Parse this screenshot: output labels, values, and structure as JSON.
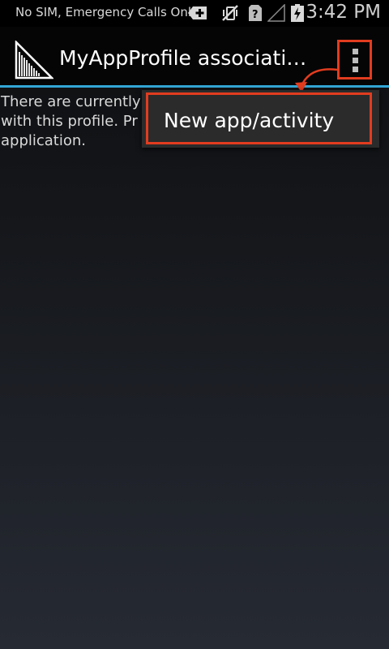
{
  "status_bar": {
    "carrier": "No SIM, Emergency Calls Only",
    "time": "3:42 PM",
    "icons": [
      "add-notification-icon",
      "vibrate-off-icon",
      "no-sim-icon",
      "no-signal-icon",
      "battery-charging-icon"
    ]
  },
  "action_bar": {
    "title": "MyAppProfile associati…",
    "logo_icon": "barcode-scanner-icon",
    "overflow_icon": "overflow-menu-icon",
    "accent_color": "#33a6d6"
  },
  "content": {
    "line1": "There are currently",
    "line2": "with this profile. Pr",
    "line3": "application."
  },
  "overflow_menu": {
    "items": [
      {
        "label": "New app/activity"
      }
    ]
  },
  "highlight_color": "#e23c1f"
}
